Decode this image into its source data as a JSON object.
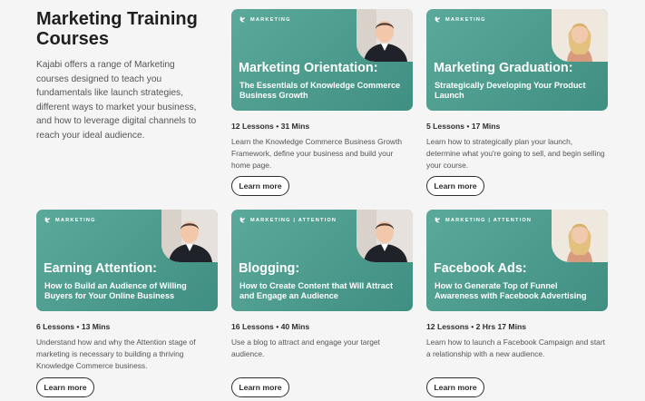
{
  "intro": {
    "title": "Marketing Training Courses",
    "description": "Kajabi offers a range of Marketing courses designed to teach you fundamentals like launch strategies, different ways to market your business, and how to leverage digital channels to reach your ideal audience."
  },
  "courses": [
    {
      "tag": "MARKETING",
      "title": "Marketing Orientation:",
      "subtitle": "The Essentials of Knowledge Commerce Business Growth",
      "meta": "12 Lessons • 31 Mins",
      "description": "Learn the Knowledge Commerce Business Growth Framework, define your business and build your home page.",
      "button": "Learn more"
    },
    {
      "tag": "MARKETING",
      "title": "Marketing Graduation:",
      "subtitle": "Strategically Developing Your Product Launch",
      "meta": "5 Lessons • 17 Mins",
      "description": "Learn how to strategically plan your launch, determine what you're going to sell, and begin selling your course.",
      "button": "Learn more"
    },
    {
      "tag": "MARKETING",
      "title": "Earning Attention:",
      "subtitle": "How to Build an Audience of Willing Buyers for Your Online Business",
      "meta": "6 Lessons • 13 Mins",
      "description": "Understand how and why the Attention stage of marketing is necessary to building a thriving Knowledge Commerce business.",
      "button": "Learn more"
    },
    {
      "tag": "MARKETING | ATTENTION",
      "title": "Blogging:",
      "subtitle": "How to Create Content that Will Attract and Engage an Audience",
      "meta": "16 Lessons • 40 Mins",
      "description": "Use a blog to attract and engage your target audience.",
      "button": "Learn more"
    },
    {
      "tag": "MARKETING | ATTENTION",
      "title": "Facebook Ads:",
      "subtitle": "How to Generate Top of Funnel Awareness with Facebook Advertising",
      "meta": "12 Lessons • 2 Hrs 17 Mins",
      "description": "Learn how to launch a Facebook Campaign and start a relationship with a new audience.",
      "button": "Learn more"
    }
  ],
  "colors": {
    "card_start": "#5ba99a",
    "card_end": "#3f8f82",
    "accent_disc": "#7fd3c6"
  },
  "icons": {
    "brand": "kajabi-k-icon",
    "photo": "instructor-photo"
  }
}
